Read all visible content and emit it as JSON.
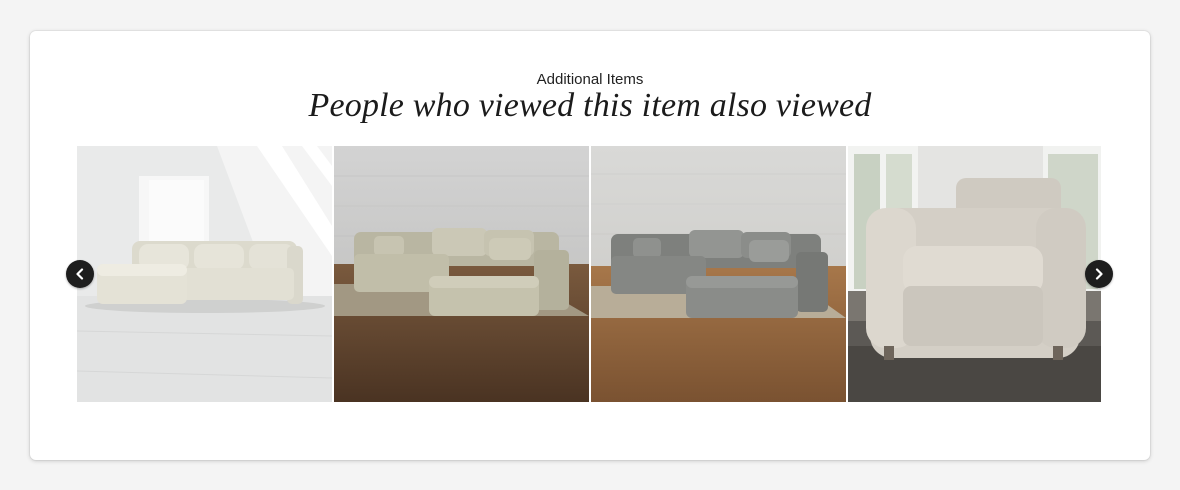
{
  "section": {
    "eyebrow": "Additional Items",
    "title": "People who viewed this item also viewed"
  },
  "carousel": {
    "prev_icon": "chevron-left-icon",
    "next_icon": "chevron-right-icon",
    "products": [
      {
        "kind": "sectional-with-ottoman",
        "setting": "white-loft",
        "fabric_color": "#e6e4d9"
      },
      {
        "kind": "sectional-with-chaise",
        "setting": "wood-floor-rug",
        "fabric_color": "#c9c6b3"
      },
      {
        "kind": "sectional-with-chaise",
        "setting": "wood-floor-rug",
        "fabric_color": "#8d8f8c"
      },
      {
        "kind": "armchair",
        "setting": "window-room",
        "fabric_color": "#d6d1c8"
      }
    ]
  }
}
